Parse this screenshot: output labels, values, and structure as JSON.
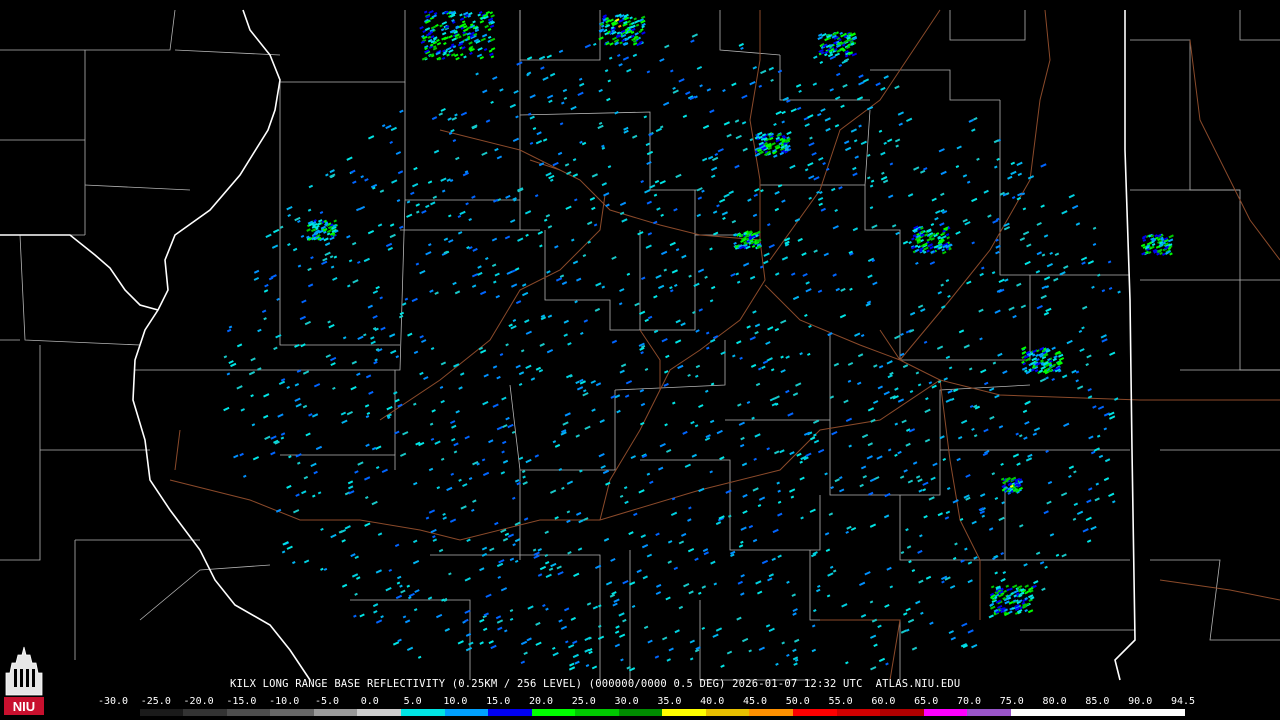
{
  "caption": "KILX LONG RANGE BASE REFLECTIVITY (0.25KM / 256 LEVEL) (000000/0000 0.5 DEG) 2026-01-07 12:32 UTC  ATLAS.NIU.EDU",
  "logo": {
    "text": "NIU",
    "icon": "university-tower-icon"
  },
  "colors": {
    "background": "#000000",
    "county_lines": "#b4b4b4",
    "state_lines": "#ffffff",
    "roads": "#8b4a2a"
  },
  "scale": {
    "labels": [
      "-30.0",
      "-25.0",
      "-20.0",
      "-15.0",
      "-10.0",
      "-5.0",
      "0.0",
      "5.0",
      "10.0",
      "15.0",
      "20.0",
      "25.0",
      "30.0",
      "35.0",
      "40.0",
      "45.0",
      "50.0",
      "55.0",
      "60.0",
      "65.0",
      "70.0",
      "75.0",
      "80.0",
      "85.0",
      "90.0",
      "94.5"
    ],
    "colors": [
      "#000000",
      "#1a1a1a",
      "#333333",
      "#4d4d4d",
      "#666666",
      "#999999",
      "#cccccc",
      "#00e5e5",
      "#00a0ff",
      "#0000f0",
      "#00ff00",
      "#00c800",
      "#008c00",
      "#ffff00",
      "#e8c000",
      "#ff9000",
      "#ff0000",
      "#d00000",
      "#b00000",
      "#ff00ff",
      "#9955c9",
      "#ffffff",
      "#ffffff",
      "#ffffff",
      "#ffffff"
    ]
  }
}
